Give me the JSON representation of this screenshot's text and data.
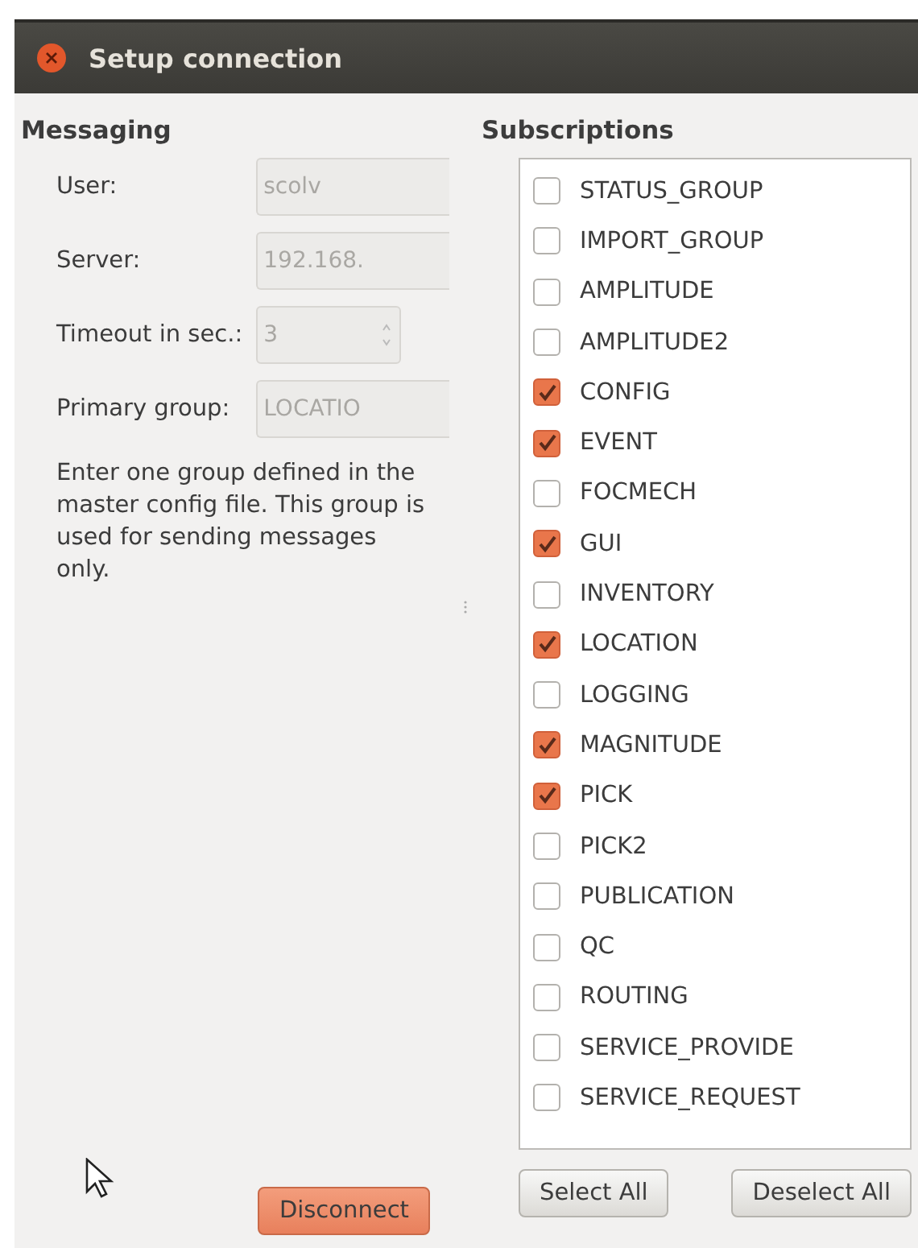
{
  "window": {
    "title": "Setup connection"
  },
  "messaging": {
    "heading": "Messaging",
    "fields": [
      {
        "label": "User:",
        "value": "scolv",
        "kind": "text"
      },
      {
        "label": "Server:",
        "value": "192.168.",
        "kind": "text"
      },
      {
        "label": "Timeout in sec.:",
        "value": "3",
        "kind": "spin"
      },
      {
        "label": "Primary group:",
        "value": "LOCATIO",
        "kind": "text"
      }
    ],
    "hint": "Enter one group defined in the master config file. This group is used for sending messages only.",
    "disconnect": "Disconnect"
  },
  "subscriptions": {
    "heading": "Subscriptions",
    "items": [
      {
        "label": "STATUS_GROUP",
        "checked": false
      },
      {
        "label": "IMPORT_GROUP",
        "checked": false
      },
      {
        "label": "AMPLITUDE",
        "checked": false
      },
      {
        "label": "AMPLITUDE2",
        "checked": false
      },
      {
        "label": "CONFIG",
        "checked": true
      },
      {
        "label": "EVENT",
        "checked": true
      },
      {
        "label": "FOCMECH",
        "checked": false
      },
      {
        "label": "GUI",
        "checked": true
      },
      {
        "label": "INVENTORY",
        "checked": false
      },
      {
        "label": "LOCATION",
        "checked": true
      },
      {
        "label": "LOGGING",
        "checked": false
      },
      {
        "label": "MAGNITUDE",
        "checked": true
      },
      {
        "label": "PICK",
        "checked": true
      },
      {
        "label": "PICK2",
        "checked": false
      },
      {
        "label": "PUBLICATION",
        "checked": false
      },
      {
        "label": "QC",
        "checked": false
      },
      {
        "label": "ROUTING",
        "checked": false
      },
      {
        "label": "SERVICE_PROVIDE",
        "checked": false
      },
      {
        "label": "SERVICE_REQUEST",
        "checked": false
      }
    ],
    "buttons": [
      "Select All",
      "Deselect All"
    ]
  }
}
